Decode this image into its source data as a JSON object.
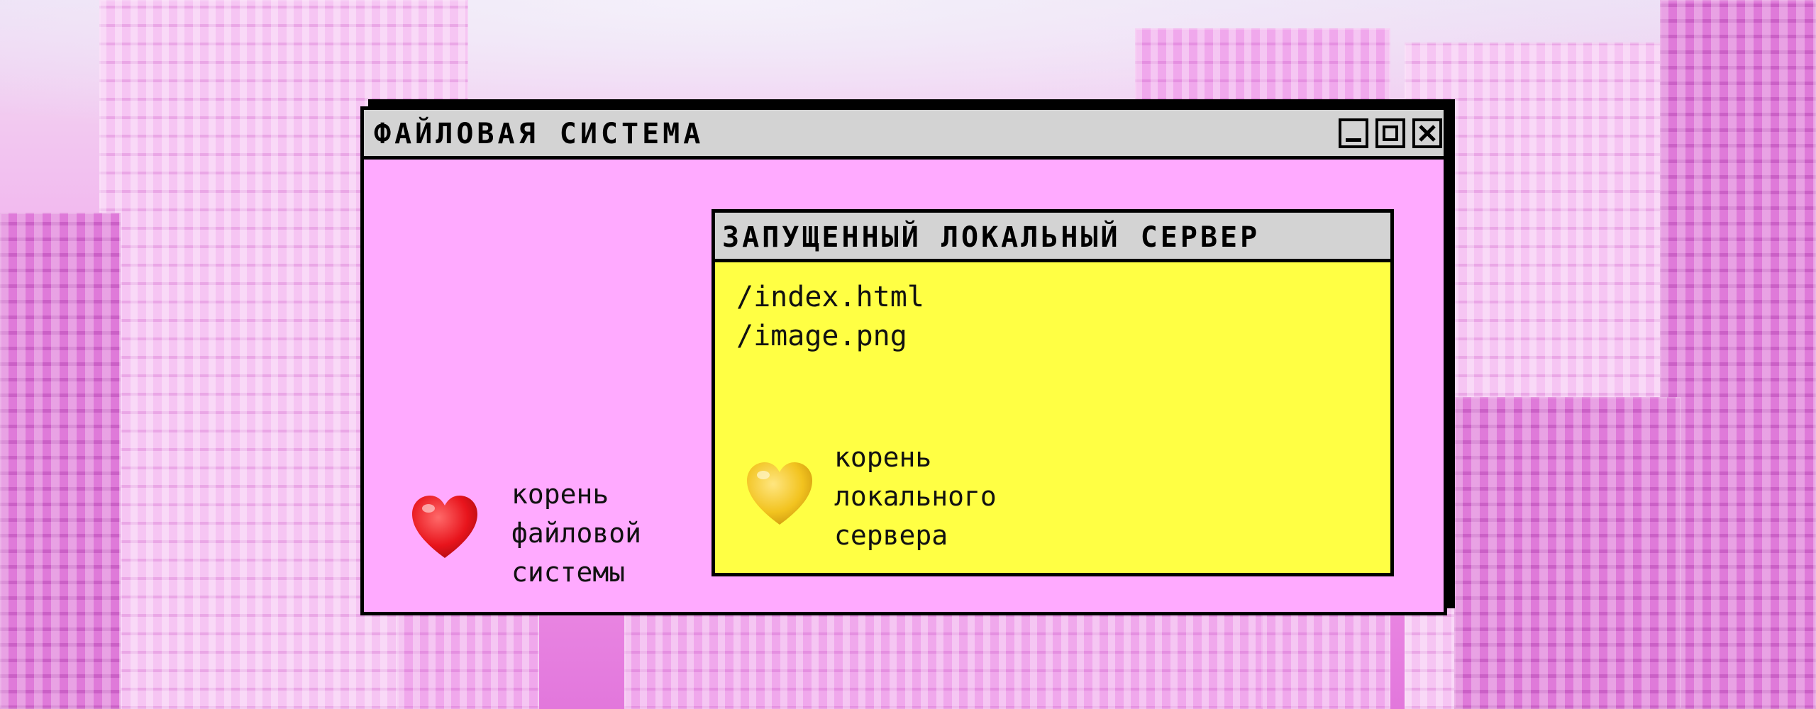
{
  "window": {
    "title": "ФАЙЛОВАЯ СИСТЕМА",
    "background_color": "#ffaaff",
    "titlebar_color": "#d3d3d3",
    "buttons": [
      "minimize-icon",
      "maximize-icon",
      "close-icon"
    ]
  },
  "inner_window": {
    "title": "ЗАПУЩЕННЫЙ ЛОКАЛЬНЫЙ СЕРВЕР",
    "background_color": "#ffff44",
    "files": [
      "/index.html",
      "/image.png"
    ]
  },
  "labels": {
    "server_root": [
      "корень",
      "локального",
      "сервера"
    ],
    "fs_root": [
      "корень",
      "файловой",
      "системы"
    ]
  },
  "icons": {
    "fs_root_icon": "red-heart-icon",
    "server_root_icon": "yellow-heart-icon",
    "red": "#e8141c",
    "yellow": "#f2c31f"
  }
}
